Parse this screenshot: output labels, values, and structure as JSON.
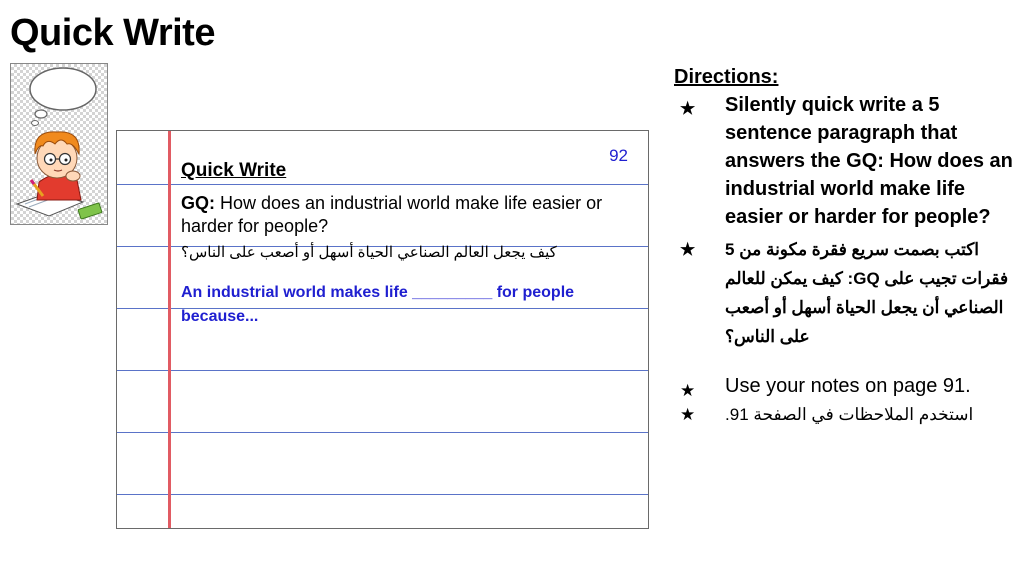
{
  "page": {
    "title": "Quick Write"
  },
  "clipart": {
    "icon": "child-writing-thought-bubble-icon"
  },
  "paper": {
    "page_number": "92",
    "title": "Quick Write",
    "gq_label": "GQ:",
    "gq_text": " How does an industrial world make life easier or harder for people?",
    "gq_arabic": "كيف يجعل العالم الصناعي الحياة أسهل أو أصعب على الناس؟",
    "sentence_starter": "An industrial world makes life _________ for people because...",
    "colors": {
      "rule_line": "#5a73c8",
      "margin_line": "#e15b63",
      "starter_text": "#1f1fd0"
    }
  },
  "directions": {
    "heading": "Directions:",
    "items": [
      {
        "text": "Silently quick write a 5 sentence paragraph that answers the GQ: How does an industrial world make life easier or harder for people?"
      },
      {
        "text": "اكتب بصمت سريع فقرة مكونة من 5 فقرات تجيب على GQ: كيف يمكن للعالم الصناعي أن يجعل الحياة أسهل أو أصعب على الناس؟"
      },
      {
        "text": "Use your notes on page 91."
      },
      {
        "text": "استخدم الملاحظات في الصفحة 91."
      }
    ],
    "bullet": "★"
  }
}
